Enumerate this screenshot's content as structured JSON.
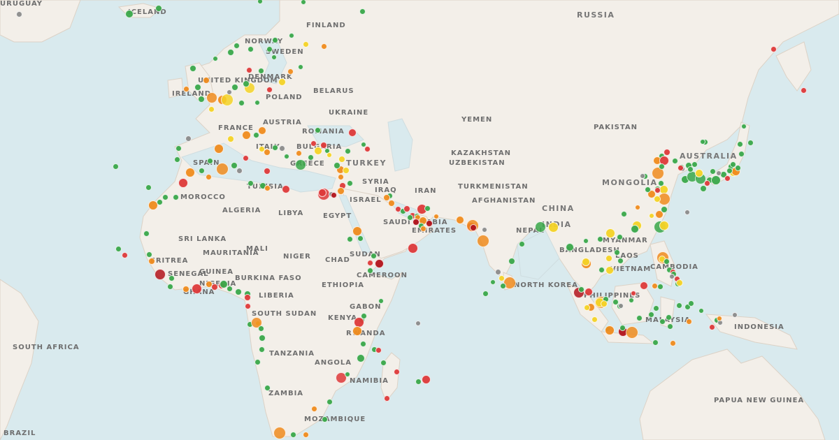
{
  "map": {
    "colors": {
      "water": "#d9eaee",
      "land": "#f3efe9",
      "border": "#dcd2c6",
      "label": "#6f6f6f"
    },
    "labels": [
      {
        "text": "RUSSIA",
        "big": true
      },
      {
        "text": "FINLAND"
      },
      {
        "text": "NORWAY"
      },
      {
        "text": "SWEDEN"
      },
      {
        "text": "ICELAND"
      },
      {
        "text": "UNITED KINGDOM"
      },
      {
        "text": "IRELAND"
      },
      {
        "text": "DENMARK"
      },
      {
        "text": "POLAND"
      },
      {
        "text": "BELARUS"
      },
      {
        "text": "UKRAINE"
      },
      {
        "text": "FRANCE"
      },
      {
        "text": "AUSTRIA"
      },
      {
        "text": "ROMANIA"
      },
      {
        "text": "ITALY"
      },
      {
        "text": "BULGARIA"
      },
      {
        "text": "SPAIN"
      },
      {
        "text": "GREECE"
      },
      {
        "text": "TURKEY",
        "big": true
      },
      {
        "text": "TUNISIA"
      },
      {
        "text": "MOROCCO"
      },
      {
        "text": "ALGERIA"
      },
      {
        "text": "LIBYA"
      },
      {
        "text": "EGYPT"
      },
      {
        "text": "SYRIA"
      },
      {
        "text": "ISRAEL"
      },
      {
        "text": "IRAQ"
      },
      {
        "text": "IRAN"
      },
      {
        "text": "SAUDI ARABIA"
      },
      {
        "text": "EMIRATES"
      },
      {
        "text": "YEMEN"
      },
      {
        "text": "KAZAKHSTAN"
      },
      {
        "text": "UZBEKISTAN"
      },
      {
        "text": "TURKMENISTAN"
      },
      {
        "text": "AFGHANISTAN"
      },
      {
        "text": "PAKISTAN"
      },
      {
        "text": "MONGOLIA",
        "big": true
      },
      {
        "text": "CHINA",
        "big": true
      },
      {
        "text": "NEPAL"
      },
      {
        "text": "INDIA",
        "big": true
      },
      {
        "text": "BANGLADESH"
      },
      {
        "text": "MYANMAR"
      },
      {
        "text": "LAOS"
      },
      {
        "text": "VIETNAM"
      },
      {
        "text": "CAMBODIA"
      },
      {
        "text": "PHILIPPINES"
      },
      {
        "text": "MALAYSIA"
      },
      {
        "text": "INDONESIA"
      },
      {
        "text": "PAPUA NEW GUINEA"
      },
      {
        "text": "AUSTRALIA",
        "big": true
      },
      {
        "text": "NORTH KOREA"
      },
      {
        "text": "SRI LANKA"
      },
      {
        "text": "MAURITANIA"
      },
      {
        "text": "MALI"
      },
      {
        "text": "NIGER"
      },
      {
        "text": "CHAD"
      },
      {
        "text": "SUDAN"
      },
      {
        "text": "ERITREA"
      },
      {
        "text": "SENEGAL"
      },
      {
        "text": "GUINEA"
      },
      {
        "text": "BURKINA FASO"
      },
      {
        "text": "NIGERIA"
      },
      {
        "text": "GHANA"
      },
      {
        "text": "LIBERIA"
      },
      {
        "text": "CAMEROON"
      },
      {
        "text": "ETHIOPIA"
      },
      {
        "text": "SOUTH SUDAN"
      },
      {
        "text": "GABON"
      },
      {
        "text": "KENYA"
      },
      {
        "text": "RWANDA"
      },
      {
        "text": "TANZANIA"
      },
      {
        "text": "ANGOLA"
      },
      {
        "text": "ZAMBIA"
      },
      {
        "text": "NAMIBIA"
      },
      {
        "text": "MOZAMBIQUE"
      },
      {
        "text": "SOUTH AFRICA"
      },
      {
        "text": "BRAZIL"
      },
      {
        "text": "URUGUAY"
      }
    ],
    "marker_legend": {
      "green": "#3aa84a",
      "yellow": "#f5d327",
      "orange": "#f08c1e",
      "red": "#de3a3a",
      "darkred": "#b3141c",
      "gray": "#8c8c8c"
    }
  }
}
